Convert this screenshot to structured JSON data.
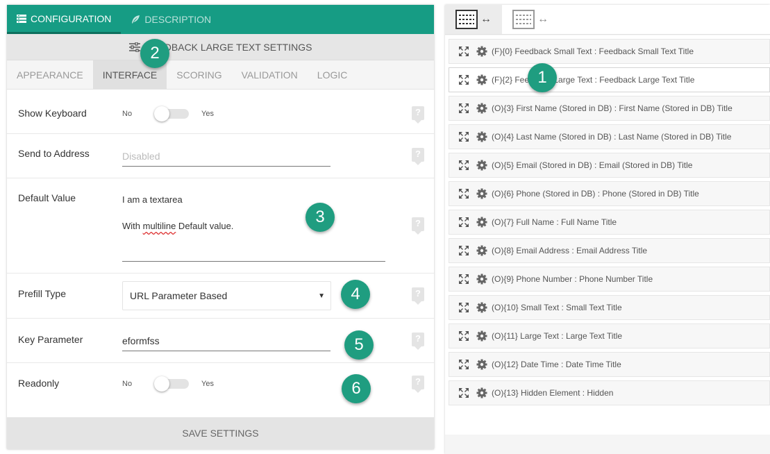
{
  "top_tabs": {
    "configuration": "CONFIGURATION",
    "description": "DESCRIPTION"
  },
  "settings_header": "FEEDBACK LARGE TEXT SETTINGS",
  "sub_tabs": [
    "APPEARANCE",
    "INTERFACE",
    "SCORING",
    "VALIDATION",
    "LOGIC"
  ],
  "active_sub_tab": "INTERFACE",
  "fields": {
    "show_keyboard": {
      "label": "Show Keyboard",
      "no": "No",
      "yes": "Yes",
      "value": "No"
    },
    "send_to_address": {
      "label": "Send to Address",
      "placeholder": "Disabled"
    },
    "default_value": {
      "label": "Default Value",
      "line1": "I am a textarea",
      "line2_pre": "With ",
      "line2_misspelled": "multiline",
      "line2_post": " Default value."
    },
    "prefill_type": {
      "label": "Prefill Type",
      "selected": "URL Parameter Based"
    },
    "key_parameter": {
      "label": "Key Parameter",
      "value": "eformfss"
    },
    "readonly": {
      "label": "Readonly",
      "no": "No",
      "yes": "Yes",
      "value": "No"
    }
  },
  "help_glyph": "?",
  "save_button": "SAVE SETTINGS",
  "layout_arrows": "↔",
  "elements": [
    "(F){0} Feedback Small Text : Feedback Small Text Title",
    "(F){2} Feedback Large Text : Feedback Large Text Title",
    "(O){3} First Name (Stored in DB) : First Name (Stored in DB) Title",
    "(O){4} Last Name (Stored in DB) : Last Name (Stored in DB) Title",
    "(O){5} Email (Stored in DB) : Email (Stored in DB) Title",
    "(O){6} Phone (Stored in DB) : Phone (Stored in DB) Title",
    "(O){7} Full Name : Full Name Title",
    "(O){8} Email Address : Email Address Title",
    "(O){9} Phone Number : Phone Number Title",
    "(O){10} Small Text : Small Text Title",
    "(O){11} Large Text : Large Text Title",
    "(O){12} Date Time : Date Time Title",
    "(O){13} Hidden Element : Hidden"
  ],
  "badges": [
    "1",
    "2",
    "3",
    "4",
    "5",
    "6"
  ],
  "colors": {
    "brand": "#169c84",
    "badge": "#1f9d80"
  }
}
